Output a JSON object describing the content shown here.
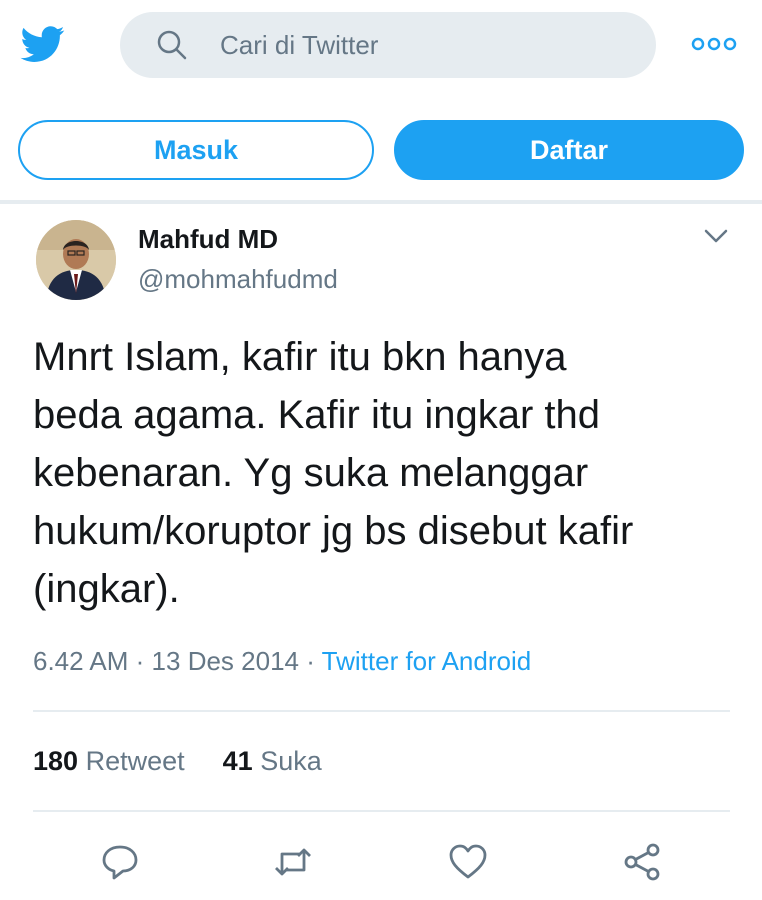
{
  "search": {
    "placeholder": "Cari di Twitter"
  },
  "auth": {
    "login_label": "Masuk",
    "signup_label": "Daftar"
  },
  "tweet": {
    "author_name": "Mahfud MD",
    "author_handle": "@mohmahfudmd",
    "text": "Mnrt Islam, kafir itu bkn hanya\nbeda agama. Kafir itu ingkar thd\nkebenaran. Yg suka melanggar\nhukum/koruptor jg bs disebut kafir\n(ingkar).",
    "time": "6.42 AM",
    "date": "13 Des 2014",
    "source": "Twitter for Android",
    "separator": "·",
    "retweet_count": "180",
    "retweet_label": "Retweet",
    "like_count": "41",
    "like_label": "Suka"
  },
  "icons": {
    "logo": "twitter-bird-icon",
    "search": "search-icon",
    "more": "more-dots-icon",
    "caret": "chevron-down-icon",
    "reply": "reply-icon",
    "retweet": "retweet-icon",
    "like": "heart-icon",
    "share": "share-icon"
  },
  "colors": {
    "accent": "#1da1f2",
    "muted": "#657786",
    "text": "#14171a",
    "divider": "#e6ecf0"
  }
}
